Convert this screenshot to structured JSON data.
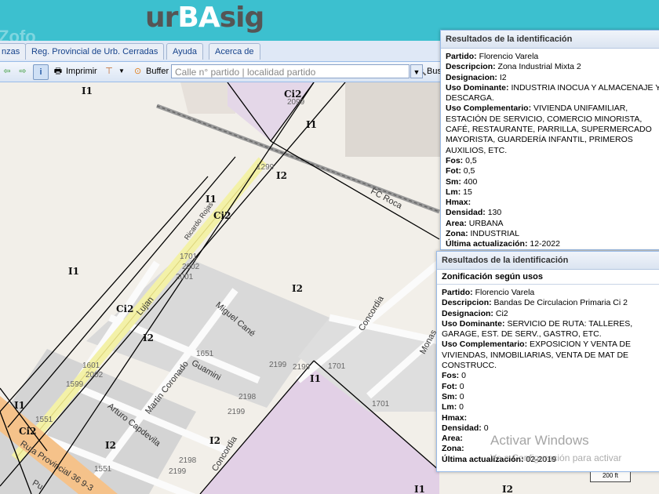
{
  "header": {
    "logo_prefix": "ur",
    "logo_highlight": "BA",
    "logo_suffix": "sig",
    "watermark": "Zofo"
  },
  "tabs": [
    "nzas",
    "Reg. Provincial de Urb. Cerradas",
    "Ayuda",
    "Acerca de"
  ],
  "toolbar": {
    "print_label": "Imprimir",
    "buffer_label": "Buffer",
    "search_placeholder": "Calle n° partido | localidad partido",
    "search_button_label": "Bus"
  },
  "map": {
    "zones": [
      {
        "text": "I1"
      },
      {
        "text": "Ci2"
      },
      {
        "text": "I1"
      },
      {
        "text": "I2"
      },
      {
        "text": "I1"
      },
      {
        "text": "Ci2"
      },
      {
        "text": "I1"
      },
      {
        "text": "I2"
      },
      {
        "text": "Ci2"
      },
      {
        "text": "I2"
      },
      {
        "text": "I1"
      },
      {
        "text": "I1"
      },
      {
        "text": "Ci2"
      },
      {
        "text": "I2"
      },
      {
        "text": "I2"
      },
      {
        "text": "I1"
      },
      {
        "text": "I2"
      }
    ],
    "numbers": [
      "2099",
      "1299",
      "1701",
      "2002",
      "2001",
      "1651",
      "1601",
      "2002",
      "1599",
      "2199",
      "2199",
      "1701",
      "2198",
      "2199",
      "1551",
      "1551",
      "2198",
      "2199",
      "1701"
    ],
    "streets": [
      "FC Roca",
      "Ricardo Rojas",
      "Lujan",
      "Miguel Cané",
      "Concordia",
      "Monas",
      "Guamini",
      "Martin Coronado",
      "Arturo Capdevila",
      "Concordia",
      "Ruta Provincial 36 9-3",
      "Pu"
    ],
    "scale": "200 ft"
  },
  "popup1": {
    "title": "Resultados de la identificación",
    "rows": [
      {
        "label": "Partido:",
        "value": "Florencio Varela"
      },
      {
        "label": "Descripcion:",
        "value": "Zona Industrial Mixta 2"
      },
      {
        "label": "Designacion:",
        "value": "I2"
      },
      {
        "label": "Uso Dominante:",
        "value": "INDUSTRIA INOCUA Y ALMACENAJE Y DESCARGA."
      },
      {
        "label": "Uso Complementario:",
        "value": "VIVIENDA UNIFAMILIAR, ESTACIÓN DE SERVICIO, COMERCIO MINORISTA, CAFÉ, RESTAURANTE, PARRILLA, SUPERMERCADO MAYORISTA, GUARDERÍA INFANTIL, PRIMEROS AUXILIOS, ETC."
      },
      {
        "label": "Fos:",
        "value": "0,5"
      },
      {
        "label": "Fot:",
        "value": "0,5"
      },
      {
        "label": "Sm:",
        "value": "400"
      },
      {
        "label": "Lm:",
        "value": "15"
      },
      {
        "label": "Hmax:",
        "value": ""
      },
      {
        "label": "Densidad:",
        "value": "130"
      },
      {
        "label": "Area:",
        "value": "URBANA"
      },
      {
        "label": "Zona:",
        "value": "INDUSTRIAL"
      },
      {
        "label": "Última actualización:",
        "value": "12-2022"
      }
    ]
  },
  "popup2": {
    "title": "Resultados de la identificación",
    "subtitle": "Zonificación según usos",
    "rows": [
      {
        "label": "Partido:",
        "value": "Florencio Varela"
      },
      {
        "label": "Descripcion:",
        "value": "Bandas De Circulacion Primaria Ci 2"
      },
      {
        "label": "Designacion:",
        "value": "Ci2"
      },
      {
        "label": "Uso Dominante:",
        "value": "SERVICIO DE RUTA: TALLERES, GARAGE, EST. DE SERV., GASTRO, ETC."
      },
      {
        "label": "Uso Complementario:",
        "value": "EXPOSICION Y VENTA DE VIVIENDAS, INMOBILIARIAS, VENTA DE MAT DE CONSTRUCC."
      },
      {
        "label": "Fos:",
        "value": "0"
      },
      {
        "label": "Fot:",
        "value": "0"
      },
      {
        "label": "Sm:",
        "value": "0"
      },
      {
        "label": "Lm:",
        "value": "0"
      },
      {
        "label": "Hmax:",
        "value": ""
      },
      {
        "label": "Densidad:",
        "value": "0"
      },
      {
        "label": "Area:",
        "value": ""
      },
      {
        "label": "Zona:",
        "value": ""
      },
      {
        "label": "Última actualización:",
        "value": "02-2019"
      }
    ]
  },
  "windows_notice": {
    "line1": "Activar Windows",
    "line2": "Ve a Configuración para activar"
  }
}
